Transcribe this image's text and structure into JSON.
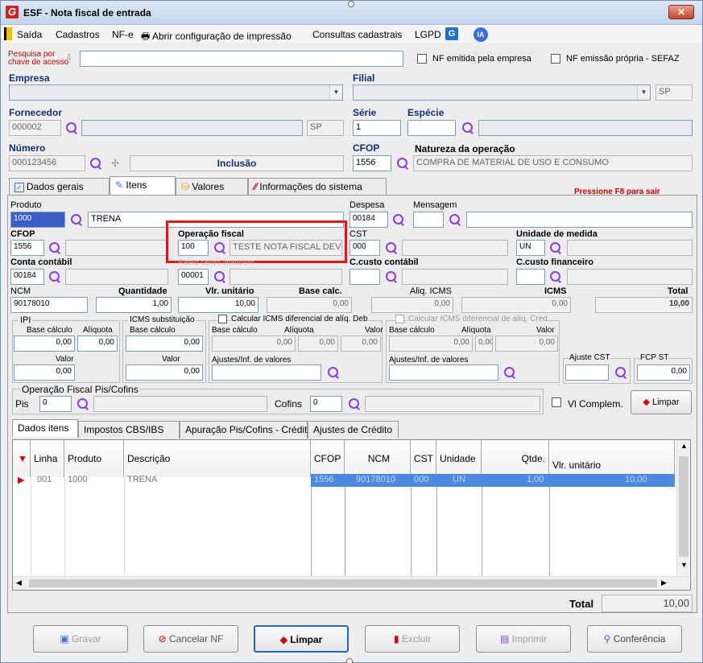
{
  "window": {
    "title": "ESF - Nota fiscal de entrada",
    "close": "✕"
  },
  "menu": {
    "saida": "Saída",
    "cadastros": "Cadastros",
    "nfe": "NF-e",
    "print": "🖶 Abrir configuração de impressão",
    "consultas": "Consultas cadastrais",
    "lgpd": "LGPD",
    "lgpd_icon": "G",
    "ia": "IA"
  },
  "search": {
    "label": "Pesquisa por chave de acesso",
    "value": "",
    "nf_empresa": "NF emitida pela empresa",
    "nf_propria": "NF emissão própria - SEFAZ"
  },
  "empresa": {
    "label": "Empresa"
  },
  "filial": {
    "label": "Filial",
    "uf": "SP"
  },
  "fornecedor": {
    "label": "Fornecedor",
    "code": "000002",
    "uf": "SP"
  },
  "serie": {
    "label": "Série",
    "value": "1"
  },
  "especie": {
    "label": "Espécie"
  },
  "numero": {
    "label": "Número",
    "value": "000123456",
    "plus": "✢",
    "status": "Inclusão"
  },
  "cfop_head": {
    "label": "CFOP",
    "value": "1556"
  },
  "natureza": {
    "label": "Natureza da operação",
    "value": "COMPRA DE MATERIAL DE USO E CONSUMO"
  },
  "tabs": [
    "Dados gerais",
    "Itens",
    "Valores",
    "Informações do sistema"
  ],
  "f8": "Pressione F8 para sair",
  "item": {
    "produto": {
      "label": "Produto",
      "code": "1000",
      "desc": "TRENA"
    },
    "despesa": {
      "label": "Despesa",
      "value": "00184"
    },
    "mensagem": {
      "label": "Mensagem"
    },
    "cfop": {
      "label": "CFOP",
      "value": "1556"
    },
    "operacao": {
      "label": "Operação fiscal",
      "code": "100",
      "desc": "TESTE NOTA FISCAL DEV"
    },
    "cst": {
      "label": "CST",
      "value": "000"
    },
    "unidade": {
      "label": "Unidade de medida",
      "value": "UN"
    },
    "conta": {
      "label": "Conta contábil",
      "value": "00184"
    },
    "rateio": {
      "label": "Rateio centro financeiro",
      "value": "00001"
    },
    "ccusto_cont": {
      "label": "C.custo contábil"
    },
    "ccusto_fin": {
      "label": "C.custo financeiro"
    },
    "ncm": {
      "label": "NCM",
      "value": "90178010"
    },
    "quantidade": {
      "label": "Quantidade",
      "value": "1,00"
    },
    "vlr_unit": {
      "label": "Vlr. unitário",
      "value": "10,00"
    },
    "base_calc": {
      "label": "Base calc.",
      "value": "0,00"
    },
    "aliq_icms": {
      "label": "Aliq. ICMS",
      "value": "0,00"
    },
    "icms": {
      "label": "ICMS",
      "value": "0,00"
    },
    "total": {
      "label": "Total",
      "value": "10,00"
    }
  },
  "ipi": {
    "title": "IPI",
    "base_label": "Base cálculo",
    "aliq_label": "Alíquota",
    "base": "0,00",
    "aliq": "0,00",
    "valor_label": "Valor",
    "valor": "0,00"
  },
  "icms_st": {
    "title": "ICMS substituição",
    "base_label": "Base cálculo",
    "base": "0,00",
    "valor_label": "Valor",
    "valor": "0,00"
  },
  "dif_deb": {
    "title": "Calcular ICMS diferencial de alíq. Deb",
    "base_label": "Base cálculo",
    "aliq_label": "Alíquota",
    "valor_label": "Valor",
    "base": "0,00",
    "aliq": "0,00",
    "valor": "0,00",
    "ajustes": "Ajustes/Inf. de valores"
  },
  "dif_cred": {
    "title": "Calcular ICMS diferencial de alíq. Cred",
    "base_label": "Base cálculo",
    "aliq_label": "Alíquota",
    "valor_label": "Valor",
    "base": "0,00",
    "aliq": "0,00",
    "valor": "0,00",
    "ajustes": "Ajustes/Inf. de valores"
  },
  "ajuste_cst": {
    "label": "Ajuste CST"
  },
  "fcp_st": {
    "label": "FCP ST",
    "value": "0,00"
  },
  "pis_cofins": {
    "title": "Operação Fiscal Pis/Cofins",
    "pis_label": "Pis",
    "pis": "0",
    "cofins_label": "Cofins",
    "cofins": "0",
    "vl_compl": "Vl Complem.",
    "limpar": "Limpar"
  },
  "subtabs": [
    "Dados itens",
    "Impostos CBS/IBS",
    "Apuração Pis/Cofins - Crédito",
    "Ajustes de Crédito"
  ],
  "grid": {
    "columns": [
      "Linha",
      "Produto",
      "Descrição",
      "CFOP",
      "NCM",
      "CST",
      "Unidade",
      "Qtde.",
      "Vlr. unitário"
    ],
    "rows": [
      {
        "linha": "001",
        "produto": "1000",
        "descricao": "TRENA",
        "cfop": "1556",
        "ncm": "90178010",
        "cst": "000",
        "unidade": "UN",
        "qtde": "1,00",
        "vlr": "10,00"
      }
    ]
  },
  "footer_total": {
    "label": "Total",
    "value": "10,00"
  },
  "buttons": {
    "gravar": "Gravar",
    "cancelar": "Cancelar NF",
    "limpar": "Limpar",
    "excluir": "Excluir",
    "imprimir": "Imprimir",
    "conferencia": "Conferência"
  },
  "colors": {
    "title_bar": "#c4d5ec",
    "accent": "#8a3fe0",
    "highlight": "#e01515",
    "label_blue": "#13307a"
  }
}
